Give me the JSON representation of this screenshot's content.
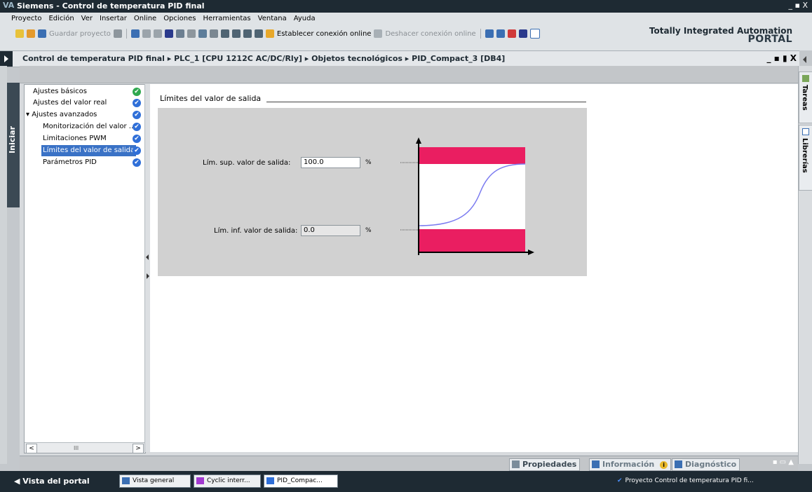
{
  "window": {
    "app_logo": "VA",
    "title": "Siemens  -  Control de temperatura PID final",
    "controls": "_ ▪ X"
  },
  "menu": [
    "Proyecto",
    "Edición",
    "Ver",
    "Insertar",
    "Online",
    "Opciones",
    "Herramientas",
    "Ventana",
    "Ayuda"
  ],
  "toolbar": {
    "save_label": "Guardar proyecto",
    "connect_label": "Establecer conexión online",
    "disconnect_label": "Deshacer conexión online"
  },
  "branding": {
    "line1": "Totally Integrated Automation",
    "line2": "PORTAL"
  },
  "breadcrumb": {
    "path": "Control de temperatura PID final  ▸  PLC_1 [CPU 1212C AC/DC/Rly]  ▸  Objetos tecnológicos  ▸  PID_Compact_3 [DB4]",
    "controls": "_ ▪ ▮ X"
  },
  "left_tab": {
    "label": "Iniciar"
  },
  "nav_tree": {
    "items": [
      {
        "label": "Ajustes básicos",
        "status": "ok-green"
      },
      {
        "label": "Ajustes del valor real",
        "status": "ok-blue"
      },
      {
        "label": "▾ Ajustes avanzados",
        "status": "ok-blue"
      },
      {
        "label": "Monitorización del valor ...",
        "status": "ok-blue"
      },
      {
        "label": "Limitaciones PWM",
        "status": "ok-blue"
      },
      {
        "label": "Límites del valor de salida",
        "status": "ok-blue",
        "selected": true
      },
      {
        "label": "Parámetros PID",
        "status": "ok-blue"
      }
    ],
    "scroll_thumb": "III",
    "scroll_left": "<",
    "scroll_right": ">"
  },
  "section": {
    "title": "Límites del valor de salida",
    "upper_label": "Lím. sup. valor de salida:",
    "upper_value": "100.0",
    "upper_unit": "%",
    "lower_label": "Lím. inf. valor de salida:",
    "lower_value": "0.0",
    "lower_unit": "%"
  },
  "right_tabs": {
    "tareas": "Tareas",
    "librerias": "Librerías"
  },
  "inspector_tabs": {
    "propiedades": "Propiedades",
    "informacion": "Información",
    "diagnostico": "Diagnóstico",
    "info_badge": "i"
  },
  "statusbar": {
    "portal_view": "◀  Vista del portal",
    "tasks": [
      "Vista general",
      "Cyclic interr...",
      "PID_Compac..."
    ],
    "message": "Proyecto Control de temperatura PID fi...",
    "message_icon": "✔"
  },
  "colors": {
    "title_bg": "#1e2a33",
    "limit_band": "#ea1e61",
    "curve": "#7b7bf0",
    "check_green": "#2fa84f",
    "check_blue": "#2f6fd8",
    "selection": "#3a72c6"
  }
}
